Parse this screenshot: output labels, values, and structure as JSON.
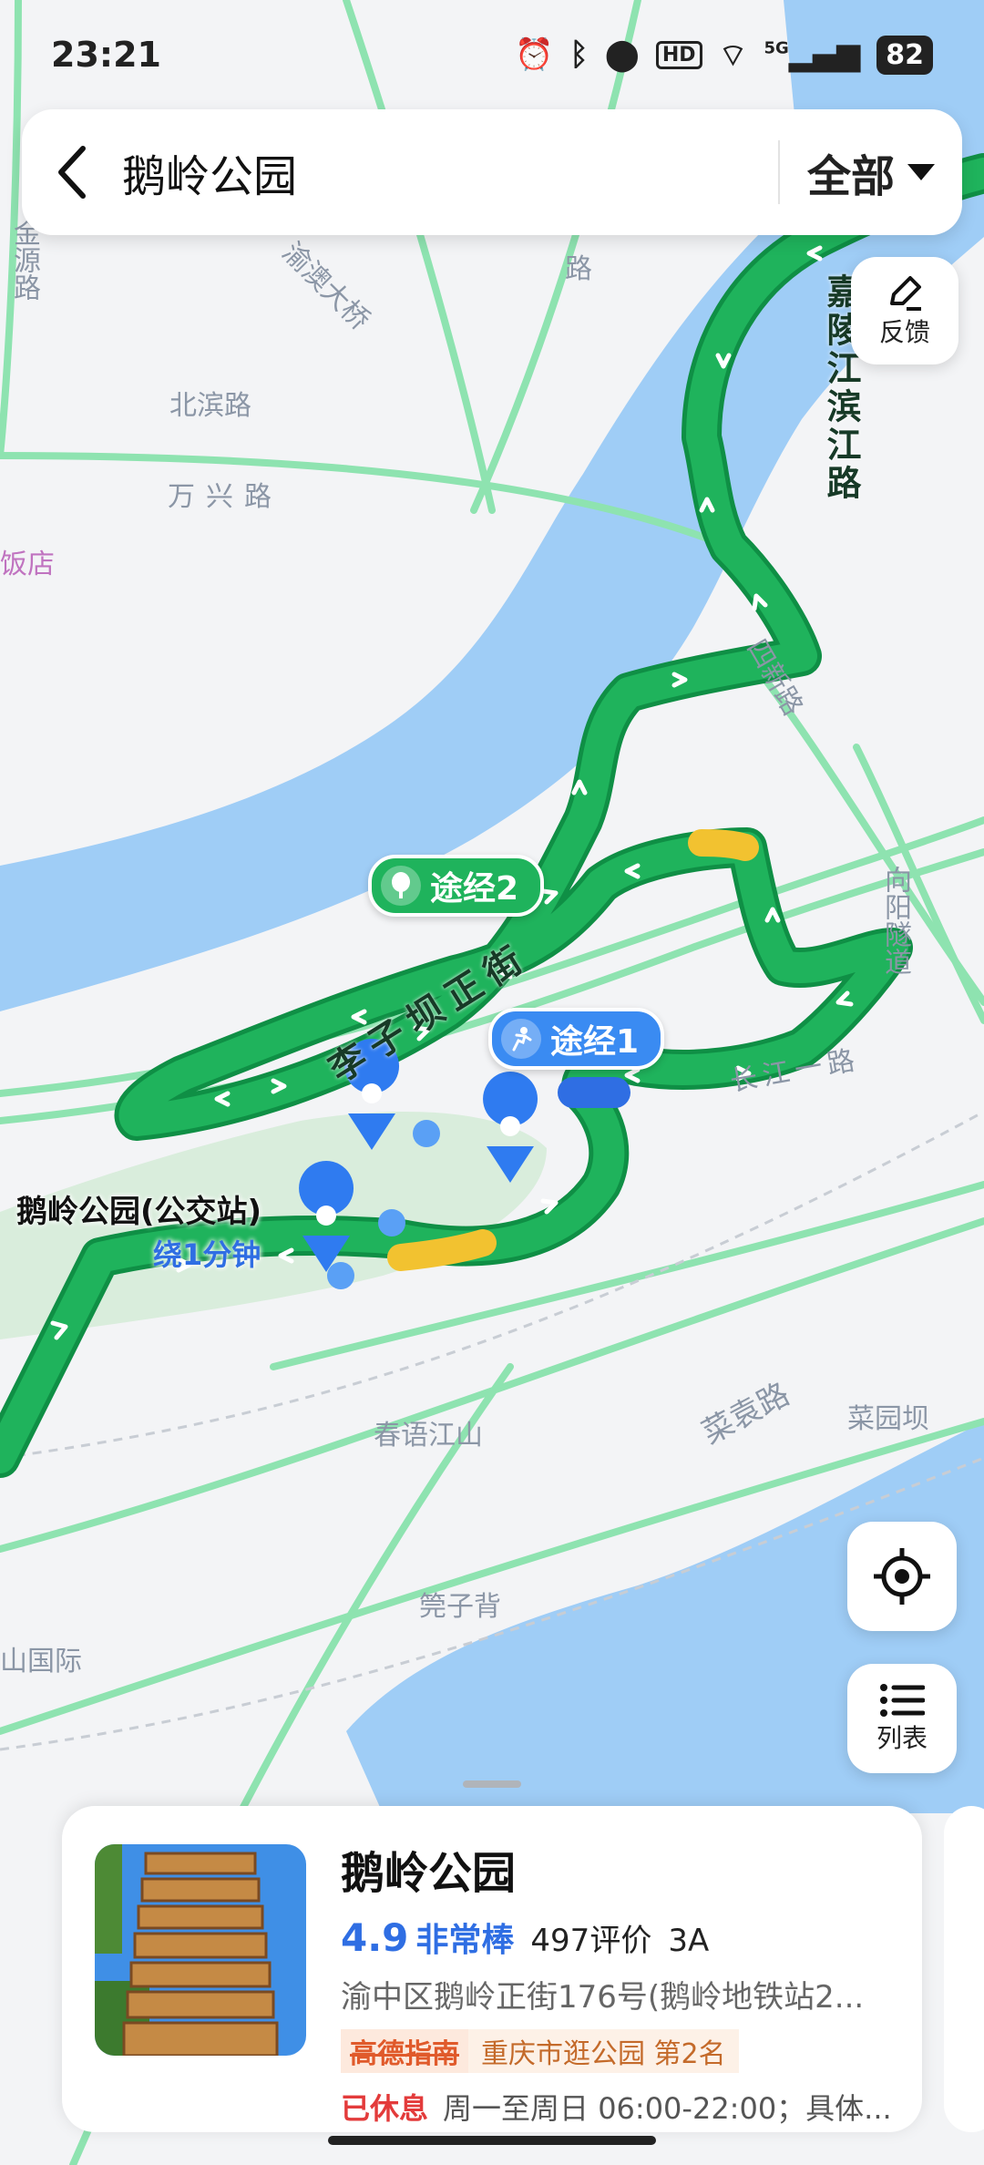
{
  "status_bar": {
    "time": "23:21",
    "battery": "82",
    "network": "5G",
    "hd": "HD"
  },
  "search_bar": {
    "title": "鹅岭公园",
    "filter_label": "全部"
  },
  "buttons": {
    "feedback_label": "反馈",
    "list_label": "列表"
  },
  "map_labels": {
    "jinyuan_road": "金源路",
    "yuao_bridge": "渝澳大桥",
    "beibin_road": "北滨路",
    "wanxing_road": "万兴路",
    "hotel_fragment": "饭店",
    "jialingjiang_road": "嘉陵江滨江路",
    "sixin_road": "四新路",
    "xiangyang_tunnel": "向阳隧道",
    "liziba_road": "李子坝正街",
    "changjiang_road": "长江一路",
    "caiyuan_road": "菜袁路",
    "caiyuanba": "菜园坝",
    "chunyu_jiangshan": "春语江山",
    "kuanzibei": "筦子背",
    "shan_guoji": "山国际",
    "road_top": "路"
  },
  "markers": {
    "via_1": "途经1",
    "via_2": "途经2",
    "bus_stop_name": "鹅岭公园(公交站)",
    "bus_stop_detour": "绕1分钟"
  },
  "poi_card": {
    "name": "鹅岭公园",
    "score": "4.9",
    "score_text": "非常棒",
    "reviews": "497评价",
    "grade": "3A",
    "address": "渝中区鹅岭正街176号(鹅岭地铁站2...",
    "guide_badge": "高德指南",
    "rank": "重庆市逛公园 第2名",
    "status": "已休息",
    "hours": "周一至周日 06:00-22:00；具体..."
  },
  "colors": {
    "route_green": "#1fb35c",
    "route_dark": "#0f8f45",
    "water": "#9fcdf6",
    "park": "#d9eddc",
    "accent_blue": "#2f6ee3",
    "closed_red": "#e33b3b"
  }
}
